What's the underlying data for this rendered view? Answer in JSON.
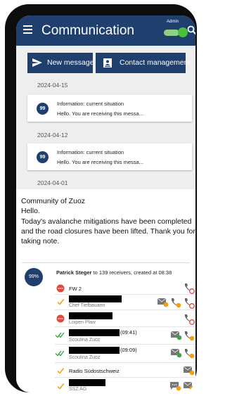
{
  "appbar": {
    "title": "Communication",
    "admin_label": "Admin"
  },
  "toolbar": {
    "new_message_label": "New message",
    "contacts_label": "Contact management"
  },
  "messages": [
    {
      "date": "2024-04-15",
      "badge": "99",
      "title": "Information: current situation",
      "body": "Hello. You are receiving this messa..."
    },
    {
      "date": "2024-04-12",
      "badge": "99",
      "title": "Information: current situation",
      "body": "Hello. You are receiving this messa..."
    }
  ],
  "expanded": {
    "date": "2024-04-01",
    "lines": [
      "Community of Zuoz",
      "Hello.",
      "Today's avalanche mitigations have been completed",
      "and the road closures have been lifted. Thank you for",
      "taking note."
    ],
    "percent": "99%",
    "sender": "Patrick Steger",
    "sender_rest": " to 139 receivers, created at 08:38"
  },
  "recipients": [
    {
      "name": "FW 2",
      "sub": "",
      "time": "",
      "status": "failed"
    },
    {
      "name": "",
      "sub": "Chef Tiefbauamt",
      "time": "",
      "status": "sent"
    },
    {
      "name": "",
      "sub": "Loipen Plaiv",
      "time": "",
      "status": "failed"
    },
    {
      "name": "",
      "sub": "Scoulina Zuoz",
      "time": "(09:41)",
      "status": "read"
    },
    {
      "name": "",
      "sub": "Scoulina Zuoz",
      "time": "(09:09)",
      "status": "read"
    },
    {
      "name": "Radio Südostschweiz",
      "sub": "",
      "time": "",
      "status": "sent"
    },
    {
      "name": "",
      "sub": "SSZ AG",
      "time": "",
      "status": "sent"
    }
  ],
  "colors": {
    "primary": "#1f3f6e",
    "failed": "#e5483a",
    "sent": "#f2a10b",
    "read": "#3fa34d"
  }
}
